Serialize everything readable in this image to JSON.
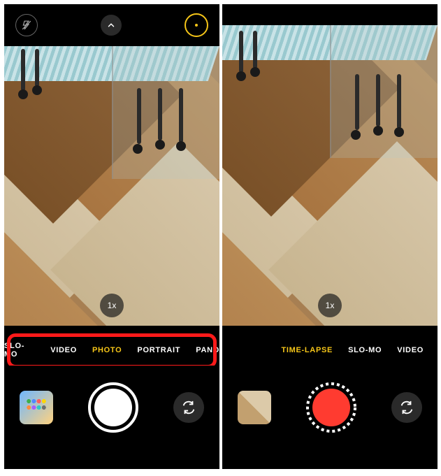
{
  "left": {
    "topbar": {
      "flash_state": "off",
      "live_photo": "on"
    },
    "zoom_label": "1x",
    "modes": [
      "SLO-MO",
      "VIDEO",
      "PHOTO",
      "PORTRAIT",
      "PANO"
    ],
    "active_mode_index": 2,
    "shutter_color": "#ffffff"
  },
  "right": {
    "zoom_label": "1x",
    "modes": [
      "TIME-LAPSE",
      "SLO-MO",
      "VIDEO"
    ],
    "active_mode_index": 0,
    "shutter_color": "#ff3b30"
  }
}
